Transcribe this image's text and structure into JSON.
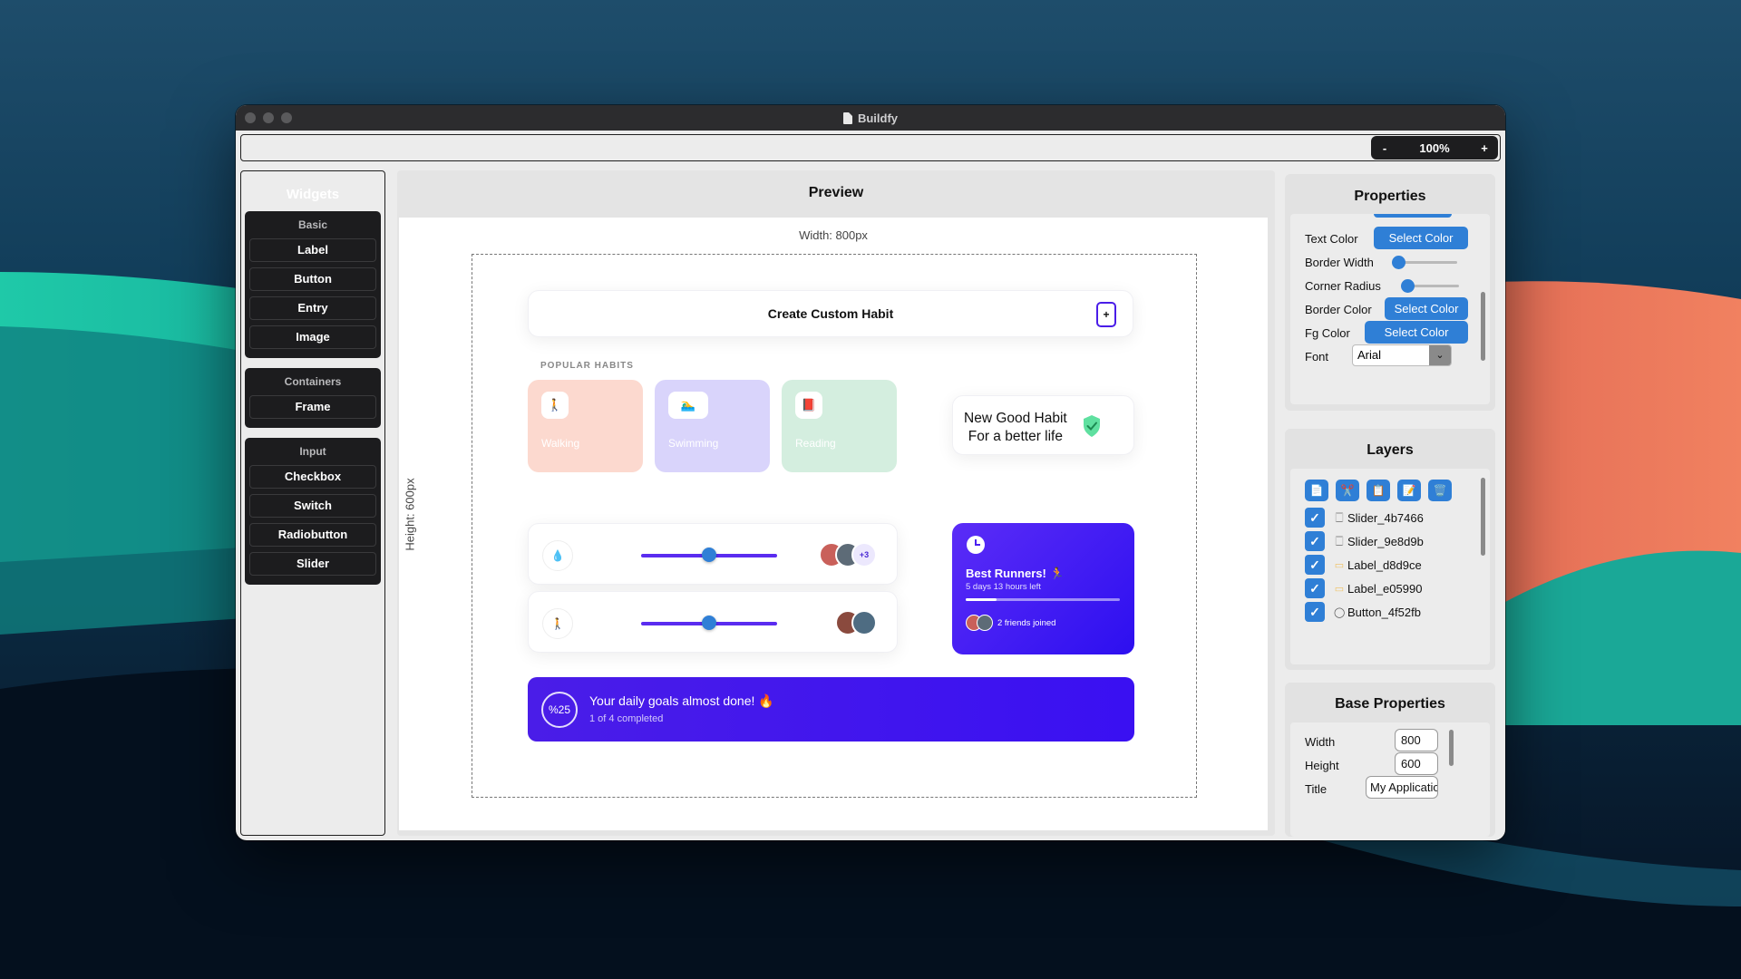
{
  "window": {
    "title": "Buildfy"
  },
  "toolbar": {
    "zoom_minus": "-",
    "zoom_level": "100%",
    "zoom_plus": "+"
  },
  "widgets": {
    "title": "Widgets",
    "groups": [
      {
        "title": "Basic",
        "items": [
          "Label",
          "Button",
          "Entry",
          "Image"
        ]
      },
      {
        "title": "Containers",
        "items": [
          "Frame"
        ]
      },
      {
        "title": "Input",
        "items": [
          "Checkbox",
          "Switch",
          "Radiobutton",
          "Slider"
        ]
      }
    ]
  },
  "preview": {
    "title": "Preview",
    "width_label": "Width: 800px",
    "height_label": "Height: 600px",
    "app": {
      "create_habit": "Create Custom Habit",
      "create_plus": "+",
      "popular_label": "POPULAR HABITS",
      "habits": [
        {
          "name": "Walking",
          "icon": "🚶"
        },
        {
          "name": "Swimming",
          "icon": "🏊‍♂"
        },
        {
          "name": "Reading",
          "icon": "📕"
        }
      ],
      "new_habit_line1": "New Good Habit",
      "new_habit_line2": "For a better life",
      "trackers": [
        {
          "icon": "💧",
          "slider_value": 0.5,
          "extra_count": "+3"
        },
        {
          "icon": "🚶",
          "slider_value": 0.5
        }
      ],
      "runners": {
        "title": "Best Runners! 🏃",
        "subtitle": "5 days 13 hours left",
        "progress": 0.2,
        "joined": "2 friends joined"
      },
      "goals": {
        "badge": "%25",
        "title": "Your daily goals almost done! 🔥",
        "subtitle": "1 of 4 completed"
      }
    }
  },
  "properties": {
    "title": "Properties",
    "text_color_label": "Text Color",
    "text_color_btn": "Select Color",
    "border_width_label": "Border Width",
    "corner_radius_label": "Corner Radius",
    "border_color_label": "Border Color",
    "border_color_btn": "Select Color",
    "fg_color_label": "Fg Color",
    "fg_color_btn": "Select Color",
    "font_label": "Font",
    "font_value": "Arial"
  },
  "layers": {
    "title": "Layers",
    "tools": [
      "📄",
      "✂️",
      "📋",
      "📝",
      "🗑️"
    ],
    "items": [
      {
        "name": "Slider_4b7466",
        "icon": "🀆"
      },
      {
        "name": "Slider_9e8d9b",
        "icon": "🀆"
      },
      {
        "name": "Label_d8d9ce",
        "icon": "▭"
      },
      {
        "name": "Label_e05990",
        "icon": "▭"
      },
      {
        "name": "Button_4f52fb",
        "icon": "◯"
      }
    ]
  },
  "base_properties": {
    "title": "Base Properties",
    "width_label": "Width",
    "width_value": "800",
    "height_label": "Height",
    "height_value": "600",
    "title_label": "Title",
    "title_value": "My Applicatior"
  },
  "colors": {
    "accent": "#2f7fd6",
    "brand_purple": "#4a1de8",
    "walking_bg": "#fcd9cf",
    "swimming_bg": "#d9d4fb",
    "reading_bg": "#d4eedf"
  }
}
